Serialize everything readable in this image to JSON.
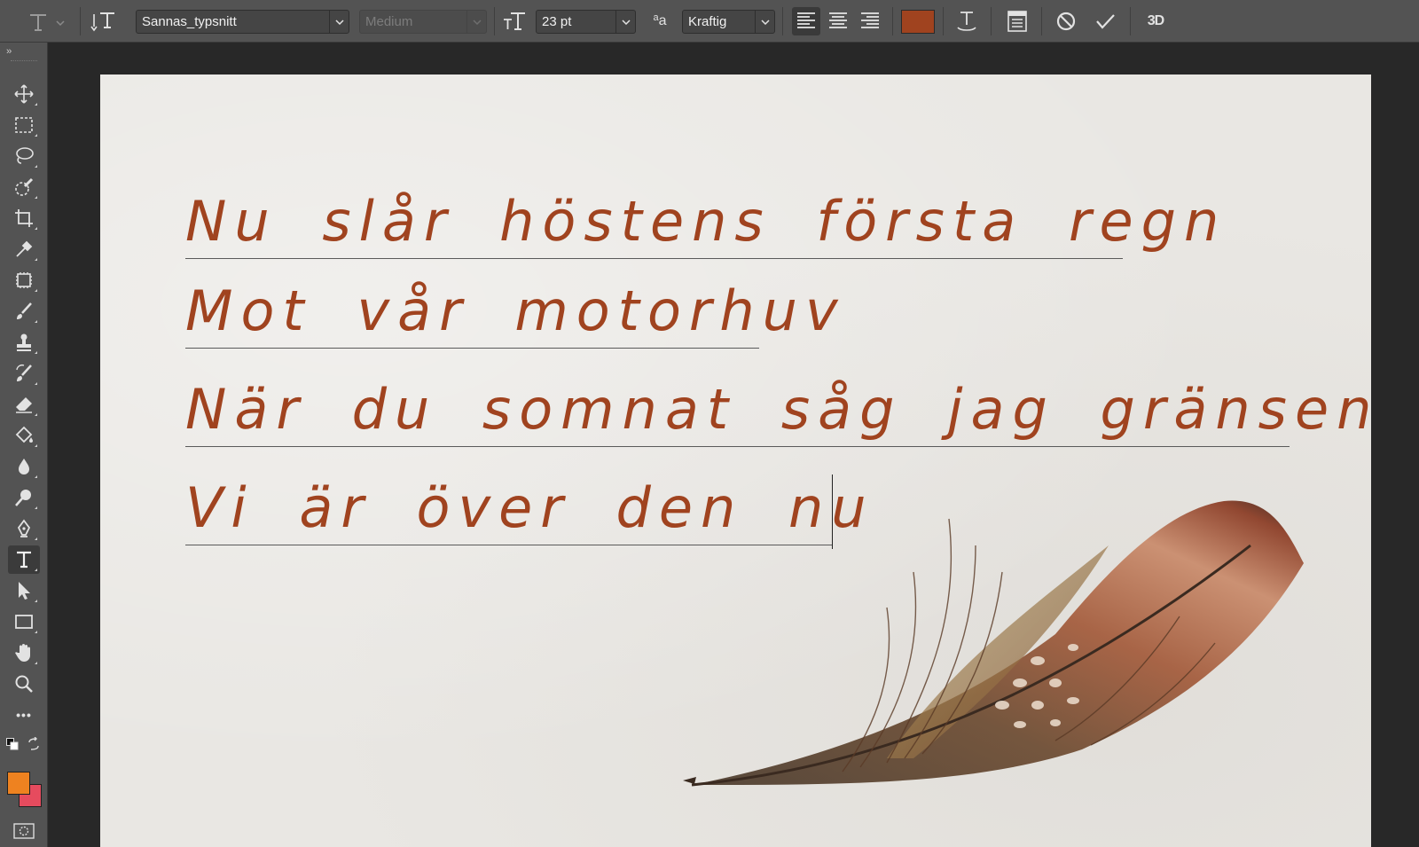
{
  "options_bar": {
    "font_family": "Sannas_typsnitt",
    "font_style": "Medium",
    "font_size": "23 pt",
    "anti_alias": "Kraftig",
    "text_color": "#a0431f",
    "icons": [
      "type-tool-icon",
      "text-orientation-icon",
      "font-size-icon",
      "anti-alias-icon",
      "align-left-icon",
      "align-center-icon",
      "align-right-icon",
      "warp-text-icon",
      "character-panel-icon",
      "cancel-icon",
      "commit-icon",
      "3d-icon"
    ],
    "three_d_label": "3D"
  },
  "toolbar": {
    "collapse_label": "››",
    "tools": [
      "move-tool-icon",
      "marquee-tool-icon",
      "lasso-tool-icon",
      "quick-select-tool-icon",
      "crop-tool-icon",
      "eyedropper-tool-icon",
      "frame-tool-icon",
      "brush-tool-icon",
      "stamp-tool-icon",
      "history-brush-tool-icon",
      "eraser-tool-icon",
      "paint-bucket-tool-icon",
      "blur-tool-icon",
      "dodge-tool-icon",
      "pen-tool-icon",
      "type-tool-icon",
      "path-select-tool-icon",
      "rectangle-tool-icon",
      "hand-tool-icon",
      "zoom-tool-icon",
      "more-tools-icon"
    ],
    "active_tool": "type-tool-icon",
    "foreground_color": "#ee8220",
    "background_color": "#e64b5e",
    "more_label": "•••"
  },
  "document": {
    "paper_color": "#e9e7e3",
    "lines": [
      "Nu slår höstens första regn",
      "Mot vår motorhuv",
      "När du somnat såg jag gränsen",
      "Vi är över den nu"
    ]
  }
}
